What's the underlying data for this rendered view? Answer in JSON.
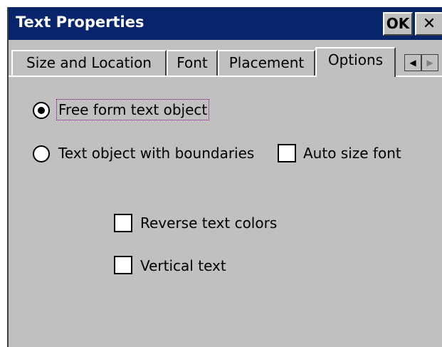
{
  "window": {
    "title": "Text Properties",
    "ok_label": "OK",
    "close_label": "✕"
  },
  "tabs": [
    {
      "label": "Size and Location"
    },
    {
      "label": "Font"
    },
    {
      "label": "Placement"
    },
    {
      "label": "Options",
      "active": true
    }
  ],
  "tab_scroll": {
    "left": "◀",
    "right": "▶"
  },
  "options": {
    "radio_free_form": {
      "label": "Free form text object",
      "checked": true
    },
    "radio_boundaries": {
      "label": "Text object with boundaries",
      "checked": false
    },
    "auto_size_font": {
      "label": "Auto size font",
      "checked": false
    },
    "reverse_text_colors": {
      "label": "Reverse text colors",
      "checked": false
    },
    "vertical_text": {
      "label": "Vertical text",
      "checked": false
    }
  },
  "colors": {
    "titlebar": "#08246b",
    "face": "#c0c0c0"
  }
}
